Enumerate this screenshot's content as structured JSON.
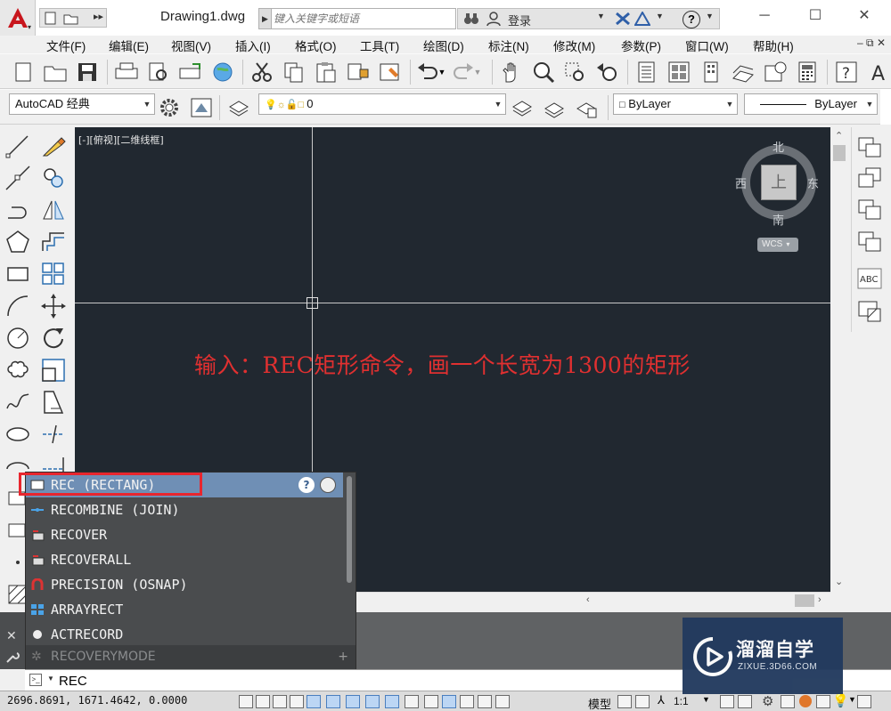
{
  "window": {
    "title": "Drawing1.dwg",
    "search_placeholder": "键入关键字或短语",
    "login": "登录",
    "help": "?"
  },
  "menu": [
    "文件(F)",
    "编辑(E)",
    "视图(V)",
    "插入(I)",
    "格式(O)",
    "工具(T)",
    "绘图(D)",
    "标注(N)",
    "修改(M)",
    "参数(P)",
    "窗口(W)",
    "帮助(H)"
  ],
  "toolbar2": {
    "workspace": "AutoCAD 经典",
    "layer": "0",
    "color": "ByLayer",
    "linetype": "ByLayer"
  },
  "canvas": {
    "view_label": "[-][俯视][二维线框]",
    "annotation": "输入：REC矩形命令，画一个长宽为1300的矩形",
    "background": "#212830"
  },
  "viewcube": {
    "north": "北",
    "south": "南",
    "east": "东",
    "west": "西",
    "face": "上",
    "wcs": "WCS"
  },
  "autocomplete": {
    "items": [
      {
        "label": "REC (RECTANG)",
        "icon": "rectangle-icon"
      },
      {
        "label": "RECOMBINE (JOIN)",
        "icon": "join-icon"
      },
      {
        "label": "RECOVER",
        "icon": "recover-icon"
      },
      {
        "label": "RECOVERALL",
        "icon": "recoverall-icon"
      },
      {
        "label": "PRECISION (OSNAP)",
        "icon": "osnap-magnet-icon"
      },
      {
        "label": "ARRAYRECT",
        "icon": "array-rect-icon"
      },
      {
        "label": "ACTRECORD",
        "icon": "record-dot-icon"
      }
    ],
    "last": "RECOVERYMODE",
    "highlight_color": "#e8262e"
  },
  "command_line": {
    "value": "REC"
  },
  "statusbar": {
    "coords": "2696.8691, 1671.4642, 0.0000",
    "model": "模型",
    "scale": "1:1"
  },
  "watermark": {
    "title": "溜溜自学",
    "subtitle": "ZIXUE.3D66.COM"
  }
}
